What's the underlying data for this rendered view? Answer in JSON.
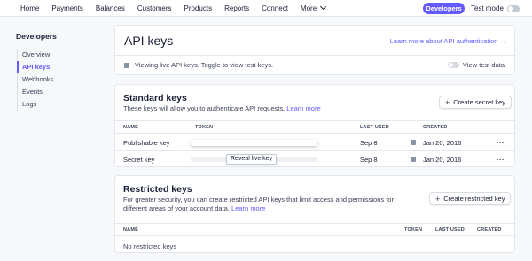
{
  "topnav": {
    "items": [
      "Home",
      "Payments",
      "Balances",
      "Customers",
      "Products",
      "Reports",
      "Connect",
      "More"
    ],
    "developers_label": "Developers",
    "test_mode_label": "Test mode"
  },
  "sidebar": {
    "title": "Developers",
    "items": [
      {
        "label": "Overview",
        "active": false
      },
      {
        "label": "API keys",
        "active": true
      },
      {
        "label": "Webhooks",
        "active": false
      },
      {
        "label": "Events",
        "active": false
      },
      {
        "label": "Logs",
        "active": false
      }
    ]
  },
  "header": {
    "title": "API keys",
    "learn_link": "Learn more about API authentication →",
    "info_text": "Viewing live API keys. Toggle to view test keys.",
    "view_test_label": "View test data"
  },
  "standard": {
    "title": "Standard keys",
    "subtitle": "These keys will allow you to authenticate API requests.",
    "learn_more": "Learn more",
    "create_label": "Create secret key",
    "columns": {
      "name": "NAME",
      "token": "TOKEN",
      "last_used": "LAST USED",
      "created": "CREATED"
    },
    "rows": [
      {
        "name": "Publishable key",
        "last_used": "Sep 8",
        "created": "Jan 20, 2016"
      },
      {
        "name": "Secret key",
        "reveal": "Reveal live key",
        "last_used": "Sep 8",
        "created": "Jan 20, 2016"
      }
    ]
  },
  "restricted": {
    "title": "Restricted keys",
    "subtitle": "For greater security, you can create restricted API keys that limit access and permissions for different areas of your account data.",
    "learn_more": "Learn more",
    "create_label": "Create restricted key",
    "columns": {
      "name": "NAME",
      "token": "TOKEN",
      "last_used": "LAST USED",
      "created": "CREATED"
    },
    "empty_text": "No restricted keys"
  },
  "colors": {
    "accent": "#635bff",
    "border": "#e3e8ee",
    "bg": "#f6f8fa"
  }
}
